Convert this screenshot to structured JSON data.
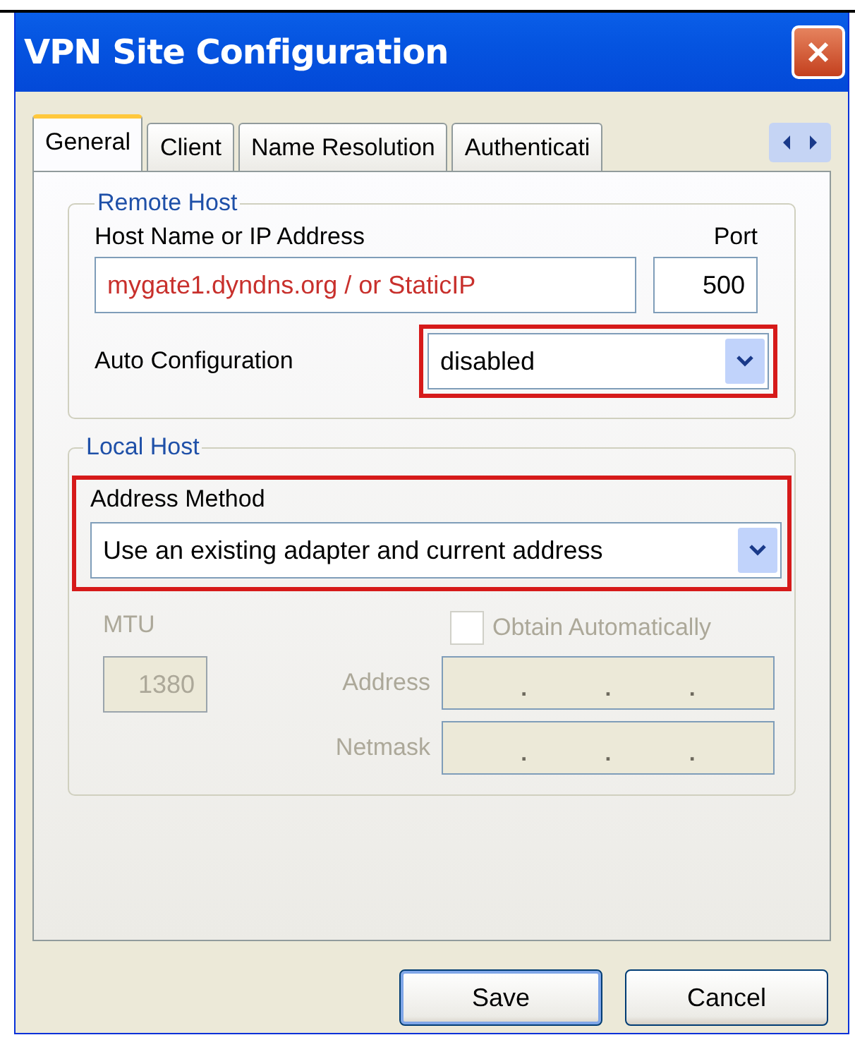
{
  "window": {
    "title": "VPN Site Configuration"
  },
  "tabs": [
    {
      "label": "General",
      "selected": true
    },
    {
      "label": "Client",
      "selected": false
    },
    {
      "label": "Name Resolution",
      "selected": false
    },
    {
      "label": "Authenticati",
      "selected": false
    }
  ],
  "remote_host": {
    "title": "Remote Host",
    "host_label": "Host Name or IP Address",
    "host_value": "mygate1.dyndns.org / or StaticIP",
    "port_label": "Port",
    "port_value": "500",
    "auto_config_label": "Auto Configuration",
    "auto_config_value": "disabled",
    "auto_config_highlighted": true
  },
  "local_host": {
    "title": "Local Host",
    "address_method_label": "Address Method",
    "address_method_value": "Use an existing adapter and current address",
    "address_method_highlighted": true,
    "mtu": {
      "label": "MTU",
      "value": "1380",
      "disabled": true
    },
    "obtain_automatically": {
      "label": "Obtain Automatically",
      "checked": false,
      "disabled": true
    },
    "ip_fields": [
      {
        "label": "Address",
        "dots": [
          ".",
          ".",
          "."
        ],
        "disabled": true
      },
      {
        "label": "Netmask",
        "dots": [
          ".",
          ".",
          "."
        ],
        "disabled": true
      }
    ]
  },
  "buttons": [
    {
      "label": "Save",
      "default": true
    },
    {
      "label": "Cancel",
      "default": false
    }
  ]
}
